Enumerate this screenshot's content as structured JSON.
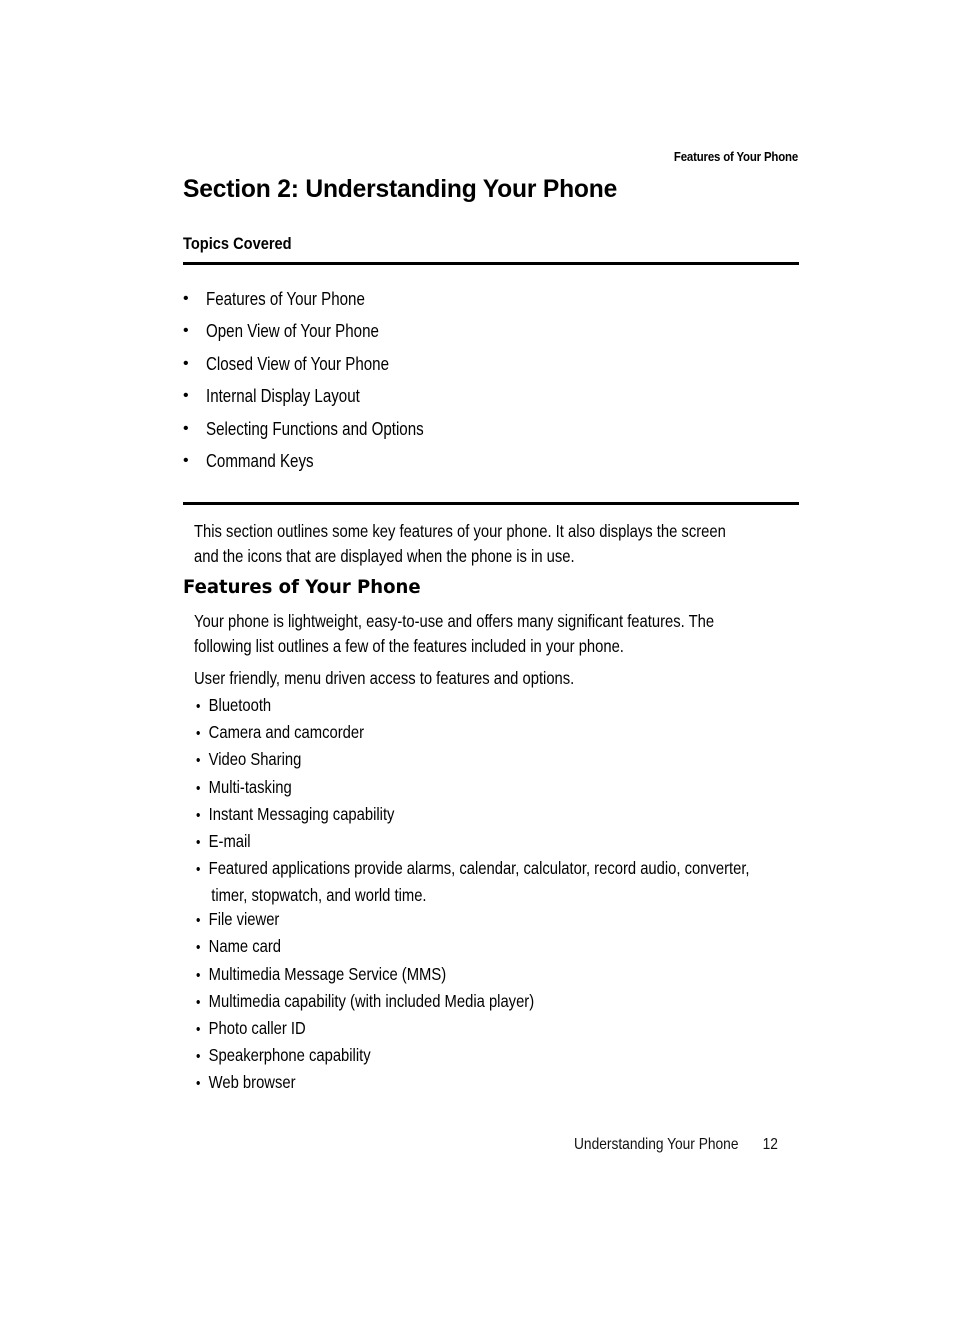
{
  "running_head": "Features of Your Phone",
  "section_title": "Section 2: Understanding Your Phone",
  "topics": {
    "heading": "Topics Covered",
    "bullet": "•",
    "items": [
      "Features of Your Phone",
      "Open View of Your Phone",
      "Closed View of Your Phone",
      "Internal Display Layout",
      "Selecting Functions and Options",
      "Command Keys"
    ]
  },
  "intro": {
    "line1": "This section outlines some key features of your phone. It also displays the screen",
    "line2": "and the icons that are displayed when the phone is in use."
  },
  "features": {
    "heading": "Features of Your Phone",
    "para_line1": "Your phone is lightweight, easy-to-use and offers many significant features. The",
    "para_line2": "following list outlines a few of the features included in your phone.",
    "lead": "User friendly, menu driven access to features and options.",
    "bullet": "•",
    "items": [
      "Bluetooth",
      "Camera and camcorder",
      "Video Sharing",
      "Multi-tasking",
      "Instant Messaging capability",
      "E-mail",
      "Featured applications provide alarms, calendar, calculator, record audio, converter,",
      "File viewer",
      "Name card",
      "Multimedia Message Service (MMS)",
      "Multimedia capability (with included Media player)",
      "Photo caller ID",
      "Speakerphone capability",
      "Web browser"
    ],
    "featured_apps_continuation": "timer, stopwatch, and world time."
  },
  "footer": {
    "title": "Understanding Your Phone",
    "page_number": "12"
  }
}
